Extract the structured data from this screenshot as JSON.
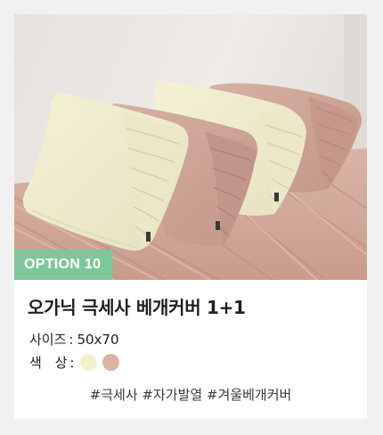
{
  "product": {
    "badge": "OPTION 10",
    "title": "오가닉 극세사 베개커버 1+1",
    "size_label": "사이즈",
    "size_value": "50x70",
    "color_label": "색 상",
    "separator": ":",
    "swatches": [
      {
        "name": "cream",
        "hex": "#f3f0cf"
      },
      {
        "name": "dusty-pink",
        "hex": "#d9b3a4"
      }
    ],
    "hashtags": "#극세사 #자가발열 #겨울베개커버"
  },
  "colors": {
    "badge": "#7fc79a",
    "card": "#ffffff",
    "page": "#f1f1f1"
  }
}
